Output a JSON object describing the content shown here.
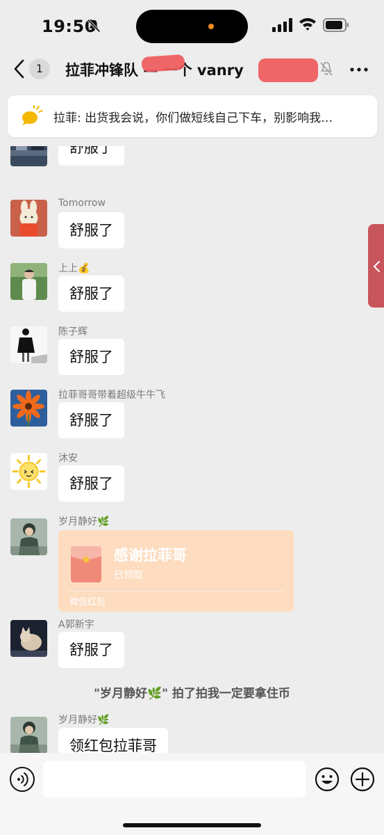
{
  "status_bar": {
    "time": "19:50"
  },
  "header": {
    "unread_count": "1",
    "title_visible": "拉菲冲锋队 — 一个 vanry"
  },
  "pinned": {
    "text": "拉菲: 出货我会说，你们做短线自己下车，别影响我…"
  },
  "messages": [
    {
      "type": "text",
      "sender": "",
      "text": "舒服了"
    },
    {
      "type": "text",
      "sender": "Tomorrow",
      "text": "舒服了"
    },
    {
      "type": "text",
      "sender": "上上💰",
      "text": "舒服了"
    },
    {
      "type": "text",
      "sender": "陈子辉",
      "text": "舒服了"
    },
    {
      "type": "text",
      "sender": "拉菲哥哥带着超级牛牛飞",
      "text": "舒服了"
    },
    {
      "type": "text",
      "sender": "沐安",
      "text": "舒服了"
    },
    {
      "type": "red_packet",
      "sender": "岁月静好🌿",
      "title": "感谢拉菲哥",
      "status": "已领取",
      "footer": "微信红包"
    },
    {
      "type": "text",
      "sender": "A郭新宇",
      "text": "舒服了"
    },
    {
      "type": "system",
      "text": "\"岁月静好🌿\" 拍了拍我一定要拿住币"
    },
    {
      "type": "text",
      "sender": "岁月静好🌿",
      "text": "领红包拉菲哥"
    }
  ],
  "input": {
    "placeholder": ""
  },
  "colors": {
    "background": "#ededed",
    "bubble": "#ffffff",
    "red_packet": "#fddcc0",
    "redaction": "#ef5a5c",
    "side_handle": "#c8555c"
  },
  "icons": {
    "status": [
      "bell-off-icon",
      "signal-icon",
      "wifi-icon",
      "battery-icon"
    ],
    "header": [
      "back-icon",
      "mute-icon",
      "more-icon"
    ],
    "input": [
      "voice-icon",
      "emoji-icon",
      "plus-icon"
    ]
  }
}
